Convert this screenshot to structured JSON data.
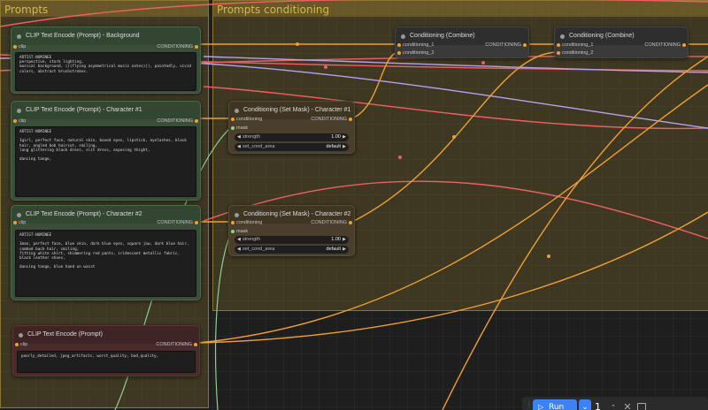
{
  "groups": {
    "prompts": {
      "title": "Prompts"
    },
    "conditioning": {
      "title": "Prompts conditioning"
    }
  },
  "nodes": {
    "bg": {
      "title": "CLIP Text Encode (Prompt) - Background",
      "in_label": "clip",
      "out_label": "CONDITIONING",
      "text": "ARTIST-NOMINEE\nperspective, stark lighting,\nmusical background, (((flying asymmetrical music notes))), paintedly, vivid\ncolors, abstract brushstrokes."
    },
    "c1": {
      "title": "CLIP Text Encode (Prompt) - Character #1",
      "in_label": "clip",
      "out_label": "CONDITIONING",
      "text": "ARTIST-NOMINEE\n\n1girl, perfect face, natural skin, boxed eyes, lipstick, eyelashes, black\nhair, angled bob haircut, smiling,\nlong glittering black dress, slit dress, exposing thight,\n\ndancing tango,"
    },
    "c2": {
      "title": "CLIP Text Encode (Prompt) - Character #2",
      "in_label": "clip",
      "out_label": "CONDITIONING",
      "text": "ARTIST-NOMINEE\n\n1man, perfect face, blue skin, dark blue eyes, square jaw, dark blue hair,\ncombed back hair, smiling,\nfitting white shirt, shimmering red pants, iridescent metallic fabric,\nblack leather shoes,\n\ndancing tango, blue hand on waist"
    },
    "neg": {
      "title": "CLIP Text Encode (Prompt)",
      "in_label": "clip",
      "out_label": "CONDITIONING",
      "text": "poorly_detailed, jpeg_artifacts, worst_quality, bad_quality,"
    },
    "mask1": {
      "title": "Conditioning (Set Mask) - Character #1",
      "in1": "conditioning",
      "in2": "mask",
      "out_label": "CONDITIONING",
      "strength_label": "strength",
      "strength_value": "1.00",
      "area_label": "set_cond_area",
      "area_value": "default"
    },
    "mask2": {
      "title": "Conditioning (Set Mask) - Character #2",
      "in1": "conditioning",
      "in2": "mask",
      "out_label": "CONDITIONING",
      "strength_label": "strength",
      "strength_value": "1.00",
      "area_label": "set_cond_area",
      "area_value": "default"
    },
    "comb1": {
      "title": "Conditioning (Combine)",
      "in1": "conditioning_1",
      "in2": "conditioning_2",
      "out_label": "CONDITIONING"
    },
    "comb2": {
      "title": "Conditioning (Combine)",
      "in1": "conditioning_1",
      "in2": "conditioning_2",
      "out_label": "CONDITIONING"
    }
  },
  "toolbar": {
    "run_label": "Run",
    "batch_count": "1"
  },
  "colors": {
    "wire_conditioning": "#f0a030",
    "wire_clip": "#f06060",
    "wire_lavender": "#b6a2f0",
    "wire_mask": "#8fd18f",
    "run_accent": "#3b82f6"
  }
}
